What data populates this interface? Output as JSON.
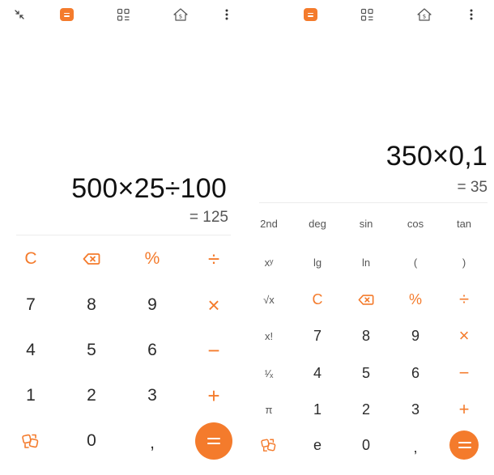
{
  "colors": {
    "accent": "#f47b2c",
    "text": "#2b2b2b",
    "muted": "#555555",
    "divider": "#ececec"
  },
  "left": {
    "toolbar_icons": [
      "collapse-icon",
      "calculator-mode-icon",
      "converter-grid-icon",
      "currency-house-icon",
      "more-vert-icon"
    ],
    "expression": "500×25÷100",
    "result": "= 125",
    "keys": {
      "clear": "C",
      "percent": "%",
      "divide": "÷",
      "n7": "7",
      "n8": "8",
      "n9": "9",
      "multiply": "×",
      "n4": "4",
      "n5": "5",
      "n6": "6",
      "minus": "−",
      "n1": "1",
      "n2": "2",
      "n3": "3",
      "plus": "+",
      "n0": "0",
      "comma": ","
    }
  },
  "right": {
    "toolbar_icons": [
      "calculator-mode-icon",
      "converter-grid-icon",
      "currency-house-icon",
      "more-vert-icon"
    ],
    "expression": "350×0,1",
    "result": "= 35",
    "keys": {
      "second": "2nd",
      "deg": "deg",
      "sin": "sin",
      "cos": "cos",
      "tan": "tan",
      "power": "xʸ",
      "lg": "lg",
      "ln": "ln",
      "lparen": "(",
      "rparen": ")",
      "sqrt": "√x",
      "clear": "C",
      "percent": "%",
      "divide": "÷",
      "factorial": "x!",
      "n7": "7",
      "n8": "8",
      "n9": "9",
      "multiply": "×",
      "reciprocal": "¹⁄ₓ",
      "n4": "4",
      "n5": "5",
      "n6": "6",
      "minus": "−",
      "pi": "π",
      "n1": "1",
      "n2": "2",
      "n3": "3",
      "plus": "+",
      "e": "e",
      "n0": "0",
      "comma": ","
    }
  }
}
